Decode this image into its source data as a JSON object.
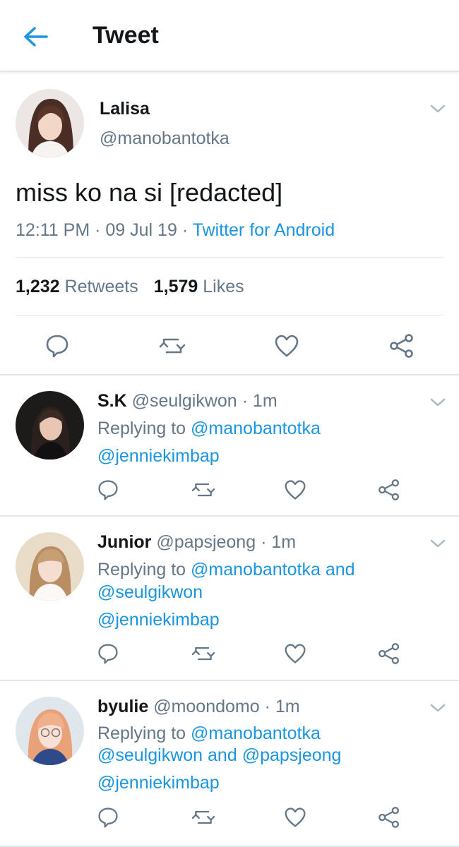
{
  "header": {
    "title": "Tweet"
  },
  "tweet": {
    "name": "Lalisa",
    "handle": "@manobantotka",
    "text": "miss ko na si [redacted]",
    "time": "12:11 PM",
    "date": "09 Jul 19",
    "separator": "·",
    "source": "Twitter for Android",
    "retweets_count": "1,232",
    "retweets_label": "Retweets",
    "likes_count": "1,579",
    "likes_label": "Likes"
  },
  "replies": [
    {
      "name": "S.K",
      "handle": "@seulgikwon",
      "time": "· 1m",
      "replying_label": "Replying to",
      "mention_1": "@manobantotka",
      "mention_2": "@jenniekimbap"
    },
    {
      "name": "Junior",
      "handle": "@papsjeong",
      "time": "· 1m",
      "replying_label": "Replying to",
      "mention_1": "@manobantotka",
      "and_1": "and",
      "mention_2": "@seulgikwon",
      "mention_3": "@jenniekimbap"
    },
    {
      "name": "byulie",
      "handle": "@moondomo",
      "time": "· 1m",
      "replying_label": "Replying to",
      "mention_1": "@manobantotka",
      "mention_2": "@seulgikwon",
      "and_1": "and",
      "mention_3": "@papsjeong",
      "mention_4": "@jenniekimbap"
    }
  ],
  "colors": {
    "accent": "#1b95e0",
    "text_primary": "#14171a",
    "text_secondary": "#657786",
    "divider": "#e1e8ed"
  },
  "icons": {
    "back": "arrow-left-icon",
    "chevron": "chevron-down-icon",
    "reply": "reply-icon",
    "retweet": "retweet-icon",
    "like": "heart-icon",
    "share": "share-icon"
  }
}
